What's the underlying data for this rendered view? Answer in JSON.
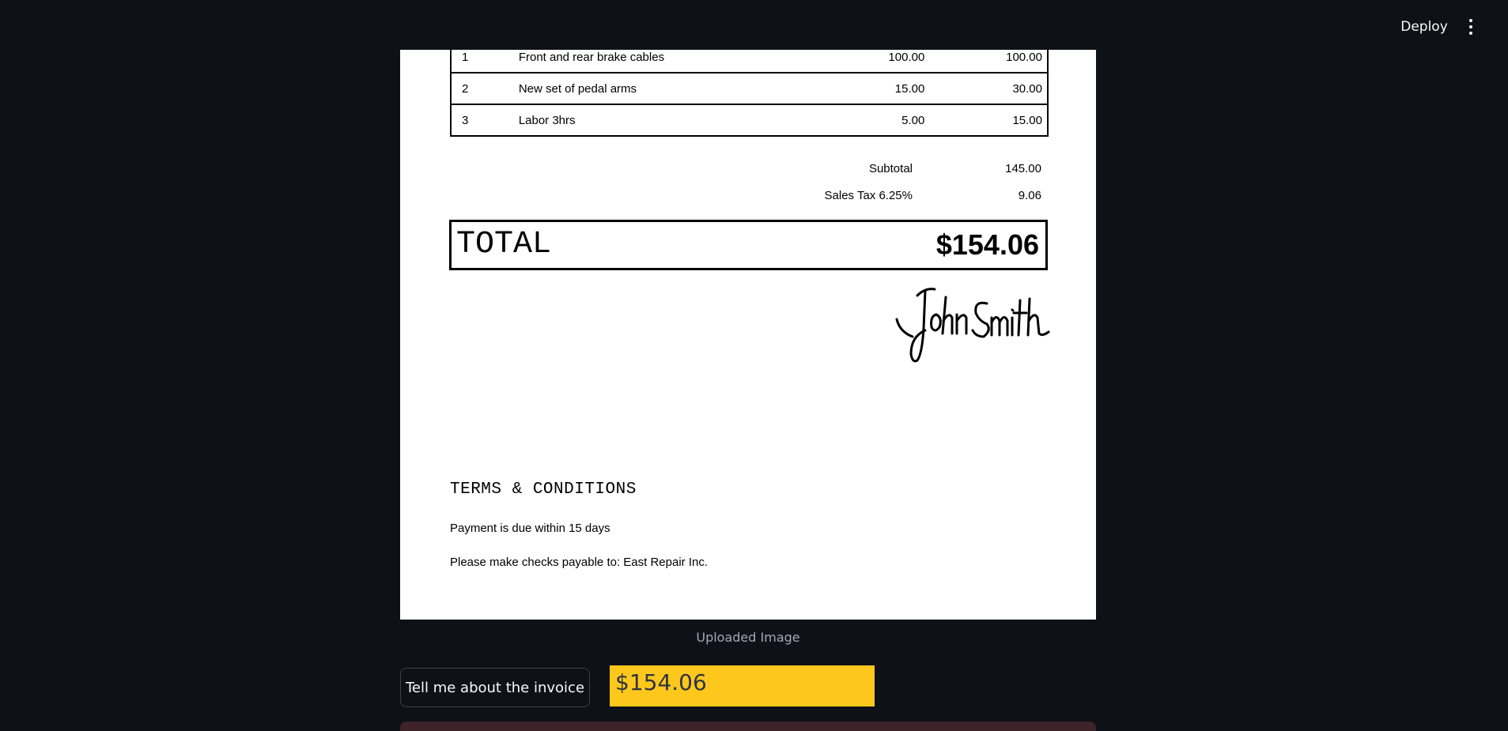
{
  "header": {
    "deploy_label": "Deploy"
  },
  "invoice": {
    "items": [
      {
        "qty": "1",
        "description": "Front and rear brake cables",
        "unit_price": "100.00",
        "amount": "100.00"
      },
      {
        "qty": "2",
        "description": "New set of pedal arms",
        "unit_price": "15.00",
        "amount": "30.00"
      },
      {
        "qty": "3",
        "description": "Labor 3hrs",
        "unit_price": "5.00",
        "amount": "15.00"
      }
    ],
    "subtotal_label": "Subtotal",
    "subtotal_value": "145.00",
    "tax_label": "Sales Tax 6.25%",
    "tax_value": "9.06",
    "total_label": "TOTAL",
    "total_value": "$154.06",
    "signature": "John Smith",
    "terms_title": "TERMS & CONDITIONS",
    "terms": [
      "Payment is due within 15 days",
      "Please make checks payable to: East Repair Inc."
    ]
  },
  "image_caption": "Uploaded Image",
  "ask_button_label": "Tell me about the invoice",
  "answer_text": "$154.06"
}
